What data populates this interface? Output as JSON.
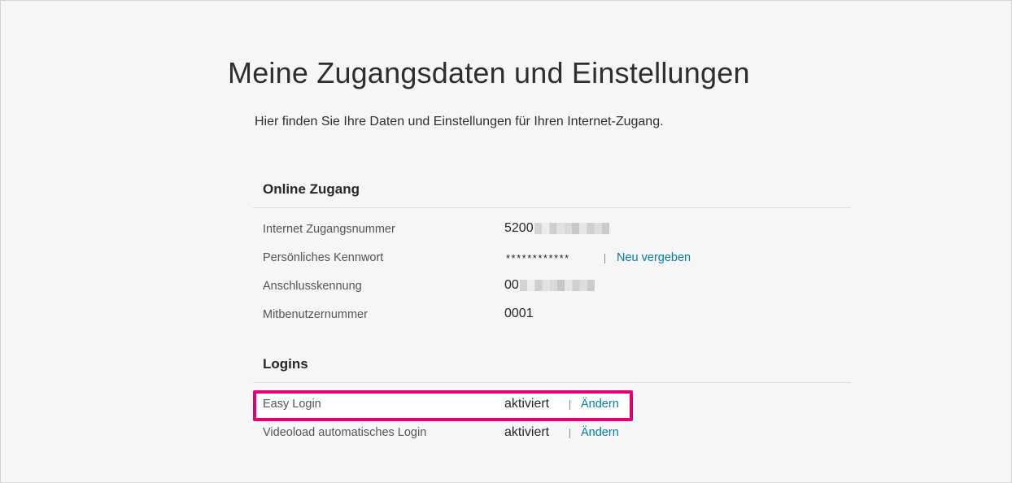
{
  "page": {
    "title": "Meine Zugangsdaten und Einstellungen",
    "subtitle": "Hier finden Sie Ihre Daten und Einstellungen für Ihren Internet-Zugang."
  },
  "online_access": {
    "heading": "Online Zugang",
    "rows": [
      {
        "label": "Internet Zugangsnummer",
        "value": "5200"
      },
      {
        "label": "Persönliches Kennwort",
        "value": "************",
        "action": "Neu vergeben"
      },
      {
        "label": "Anschlusskennung",
        "value": "00"
      },
      {
        "label": "Mitbenutzernummer",
        "value": "0001"
      }
    ]
  },
  "logins": {
    "heading": "Logins",
    "rows": [
      {
        "label": "Easy Login",
        "value": "aktiviert",
        "action": "Ändern",
        "highlighted": true
      },
      {
        "label": "Videoload automatisches Login",
        "value": "aktiviert",
        "action": "Ändern"
      }
    ]
  },
  "colors": {
    "highlight": "#e20074",
    "link": "#007ea8",
    "background": "#f6f6f6"
  }
}
